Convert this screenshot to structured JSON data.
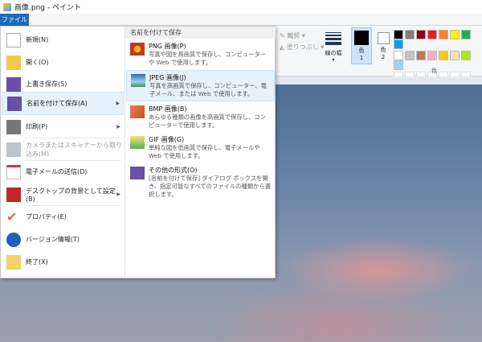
{
  "window": {
    "title": "画像.png - ペイント"
  },
  "file_tab": "ファイル",
  "ribbon": {
    "outline": "輪郭 ▾",
    "fill": "塗りつぶし ▾",
    "size": "線の幅",
    "color1": "色",
    "color1_num": "1",
    "color2": "色",
    "color2_num": "2",
    "colors_group": "色",
    "palette_row1": [
      "#000000",
      "#7f7f7f",
      "#880015",
      "#ed1c24",
      "#ff7f27",
      "#fff200",
      "#22b14c",
      "#00a2e8"
    ],
    "palette_row2": [
      "#ffffff",
      "#c3c3c3",
      "#b97a57",
      "#ffaec9",
      "#ffc90e",
      "#efe4b0",
      "#b5e61d",
      "#99d9ea"
    ]
  },
  "menu": {
    "items": [
      {
        "label": "新規(N)"
      },
      {
        "label": "開く(O)"
      },
      {
        "label": "上書き保存(S)"
      },
      {
        "label": "名前を付けて保存(A)"
      },
      {
        "label": "印刷(P)"
      },
      {
        "label": "カメラまたはスキャナーから取り込み(M)"
      },
      {
        "label": "電子メールの送信(D)"
      },
      {
        "label": "デスクトップの背景として設定(B)"
      },
      {
        "label": "プロパティ(E)"
      },
      {
        "label": "バージョン情報(T)"
      },
      {
        "label": "終了(X)"
      }
    ],
    "submenu": {
      "header": "名前を付けて保存",
      "items": [
        {
          "title": "PNG 画像(P)",
          "desc": "写真や図を高画質で保存し、コンピューターや Web で使用します。"
        },
        {
          "title": "JPEG 画像(J)",
          "desc": "写真を高画質で保存し、コンピューター、電子メール、または Web で使用します。"
        },
        {
          "title": "BMP 画像(B)",
          "desc": "あらゆる種類の画像を高画質で保存し、コンピューターで使用します。"
        },
        {
          "title": "GIF 画像(G)",
          "desc": "単純な図を低画質で保存し、電子メールや Web で使用します。"
        },
        {
          "title": "その他の形式(O)",
          "desc": "[名前を付けて保存] ダイアログ ボックスを開き、指定可能なすべてのファイルの種類から選択します。"
        }
      ]
    }
  }
}
